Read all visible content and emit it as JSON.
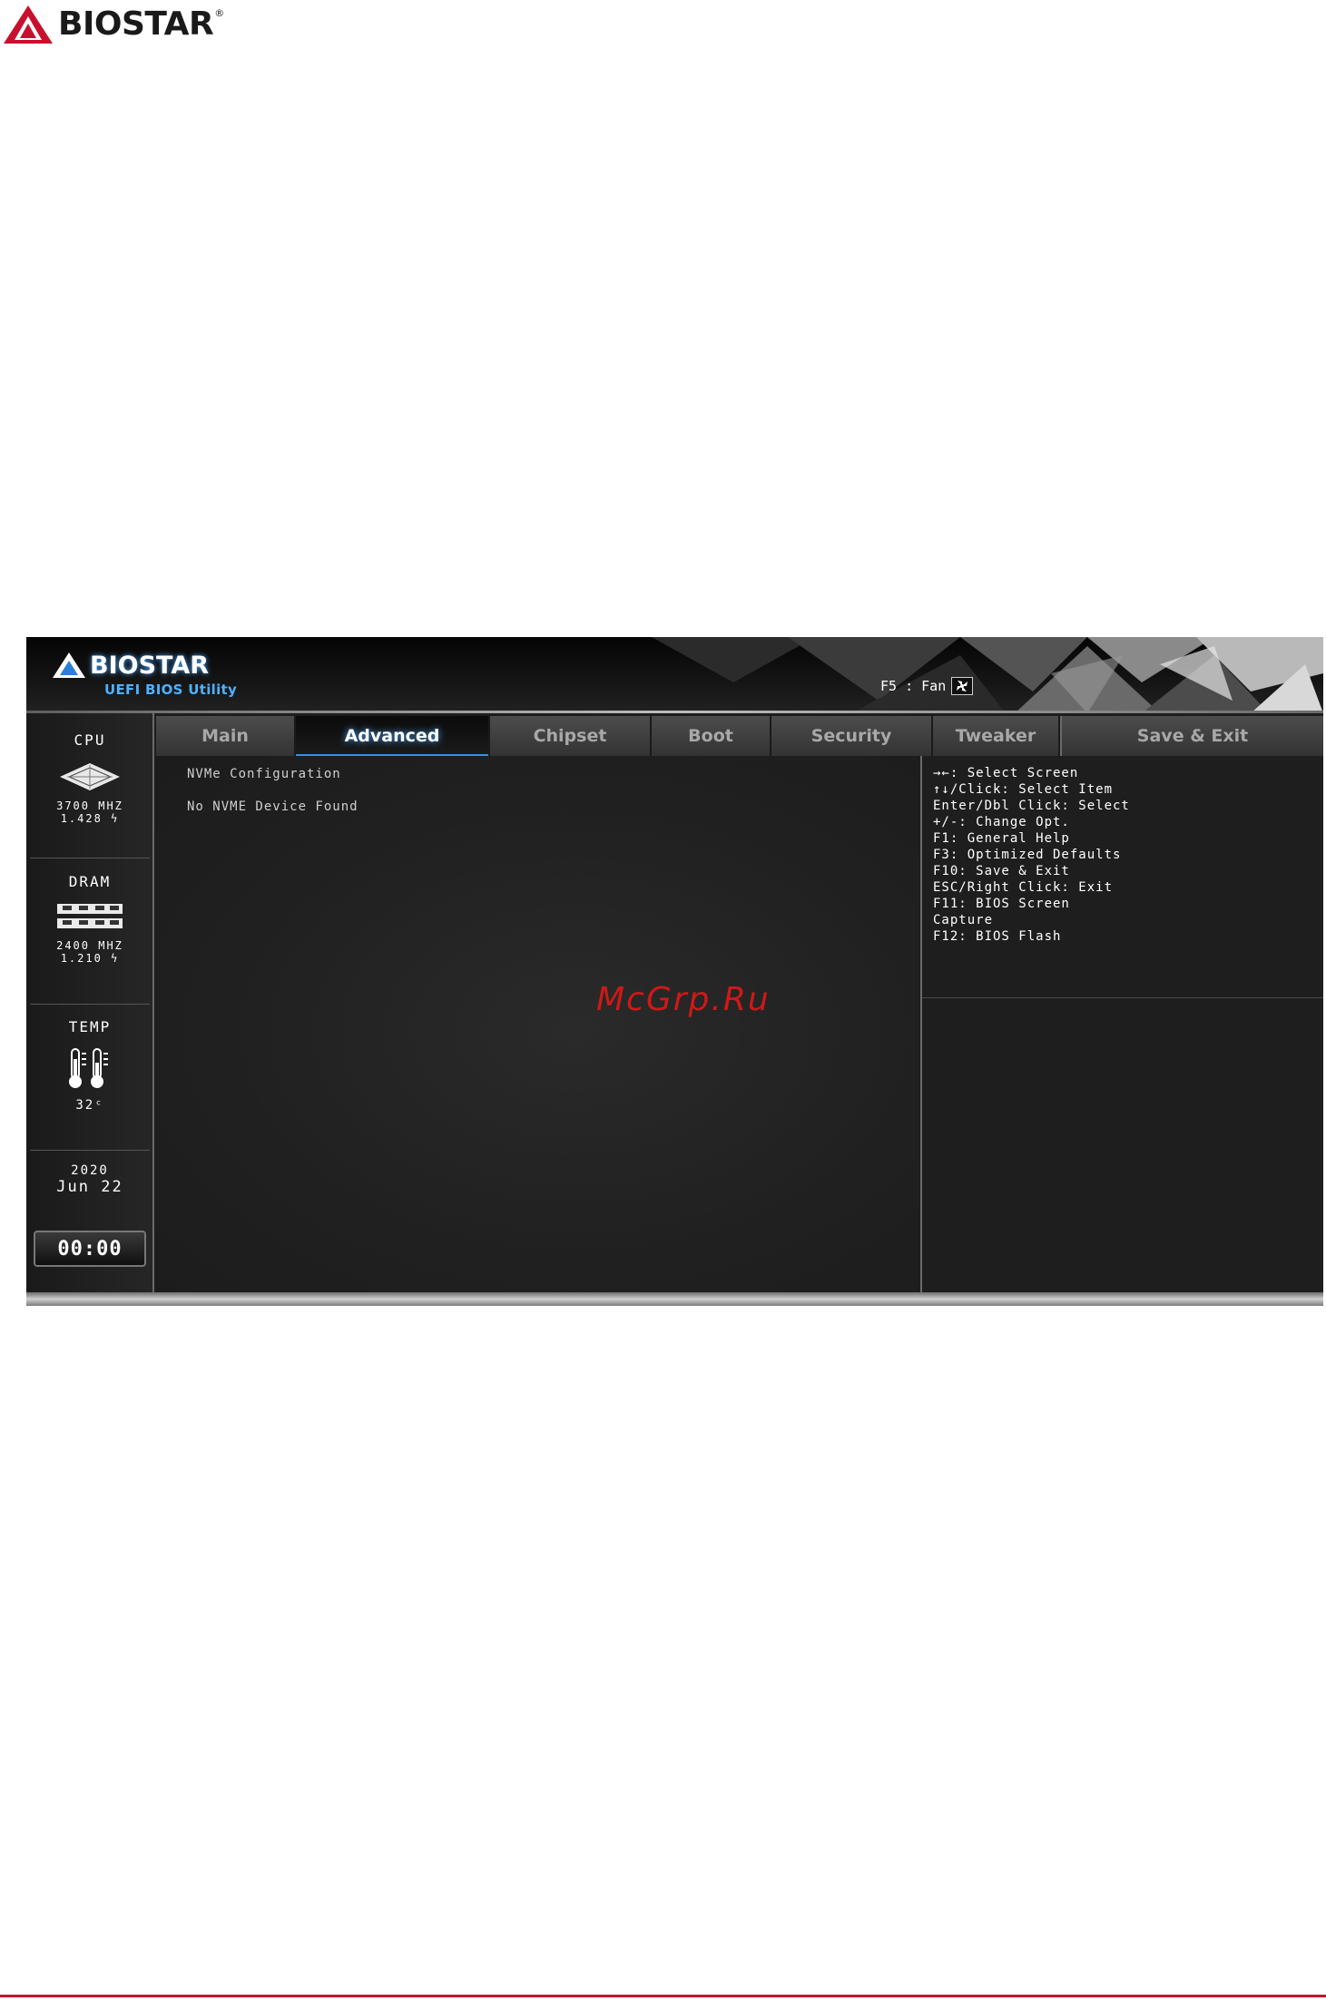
{
  "doc_header": {
    "brand": "BIOSTAR",
    "reg_mark": "®"
  },
  "bios": {
    "brand": "BIOSTAR",
    "subtitle": "UEFI BIOS Utility",
    "fan_hint": "F5 : Fan",
    "tabs": [
      {
        "label": "Main"
      },
      {
        "label": "Advanced"
      },
      {
        "label": "Chipset"
      },
      {
        "label": "Boot"
      },
      {
        "label": "Security"
      },
      {
        "label": "Tweaker"
      },
      {
        "label": "Save & Exit"
      }
    ],
    "sidebar": {
      "cpu": {
        "title": "CPU",
        "freq": "3700 MHZ",
        "volt": "1.428 ϟ"
      },
      "dram": {
        "title": "DRAM",
        "freq": "2400 MHZ",
        "volt": "1.210 ϟ"
      },
      "temp": {
        "title": "TEMP",
        "value": "32ᶜ"
      },
      "date": {
        "year": "2020",
        "month_day": "Jun  22"
      },
      "clock": "00:00"
    },
    "main": {
      "rows": [
        {
          "label": "NVMe Configuration"
        },
        {
          "label": "No NVME Device Found"
        }
      ],
      "watermark": "McGrp.Ru"
    },
    "help": [
      "→←: Select Screen",
      "↑↓/Click: Select Item",
      "Enter/Dbl Click: Select",
      "+/-: Change Opt.",
      "F1: General Help",
      "F3: Optimized Defaults",
      "F10: Save & Exit",
      "ESC/Right Click: Exit",
      "F11: BIOS Screen",
      "Capture",
      "F12: BIOS Flash"
    ],
    "colors": {
      "accent": "#4aa6ff",
      "brand_red": "#c8102e",
      "watermark": "#d01818"
    }
  }
}
